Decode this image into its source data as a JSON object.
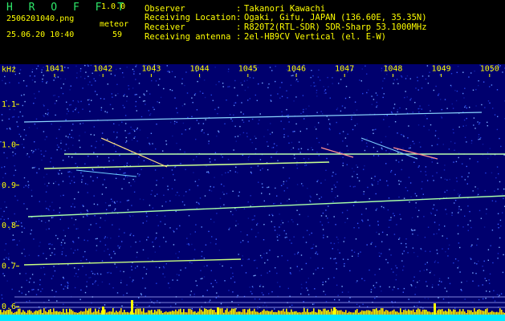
{
  "app": {
    "name": "H R O F F T",
    "version": "1.0.0"
  },
  "file": {
    "name": "2506201040.png",
    "datetime": "25.06.20 10:40"
  },
  "detection": {
    "label": "meteor",
    "count": "59"
  },
  "info": [
    {
      "label": "Observer",
      "value": "Takanori Kawachi"
    },
    {
      "label": "Receiving Location",
      "value": "Ogaki, Gifu, JAPAN (136.60E, 35.35N)"
    },
    {
      "label": "Receiver",
      "value": "R820T2(RTL-SDR) SDR-Sharp 53.1000MHz"
    },
    {
      "label": "Receiving antenna",
      "value": "2el-HB9CV Vertical (el. E-W)"
    }
  ],
  "axis": {
    "unit": "kHz",
    "x_ticks": [
      "1041",
      "1042",
      "1043",
      "1044",
      "1045",
      "1046",
      "1047",
      "1048",
      "1049",
      "1050"
    ],
    "y_ticks": [
      "1.1",
      "1.0",
      "0.9",
      "0.8",
      "0.7",
      "0.6"
    ]
  },
  "colors": {
    "background": "#000080",
    "trace": "#9aff9a",
    "level": "#ffff00",
    "text": "#ffff00"
  }
}
